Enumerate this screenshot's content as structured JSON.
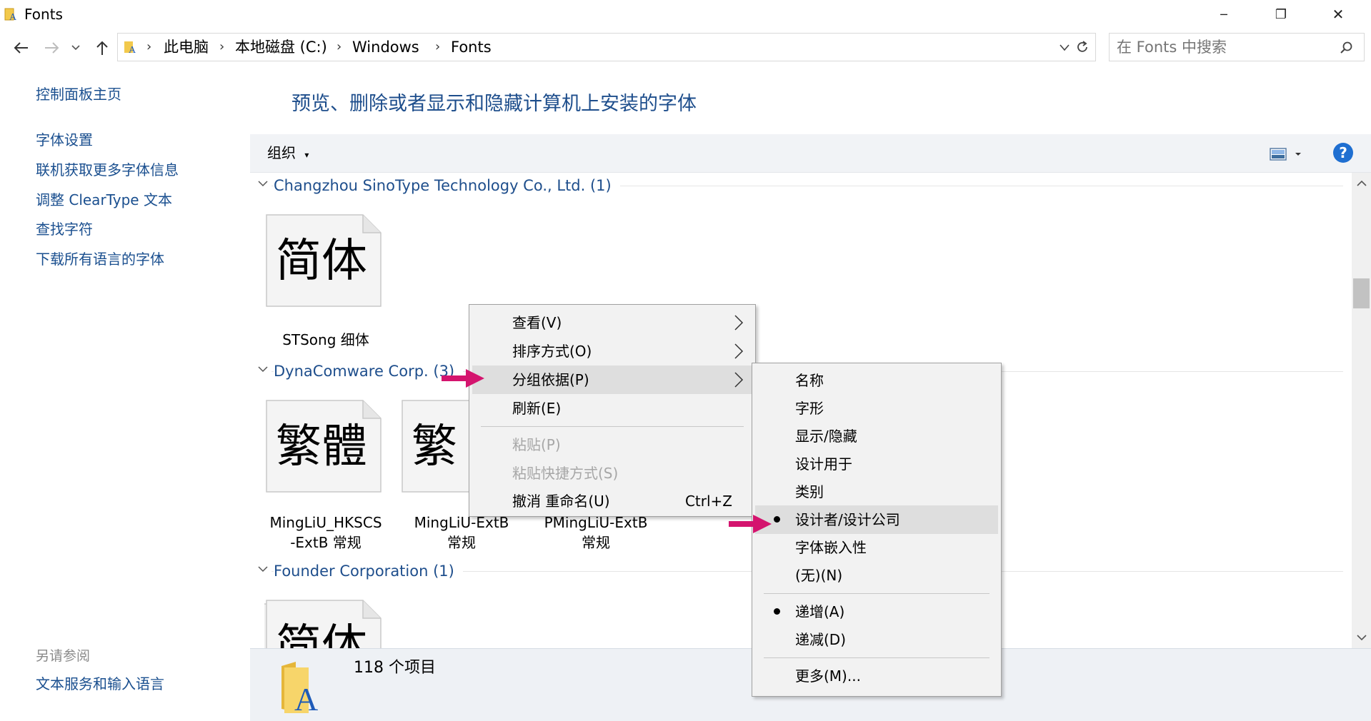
{
  "window": {
    "title": "Fonts",
    "controls": {
      "minimize": "─",
      "maximize": "❐",
      "close": "✕"
    }
  },
  "nav": {
    "breadcrumb": [
      "此电脑",
      "本地磁盘 (C:)",
      "Windows",
      "Fonts"
    ],
    "search_placeholder": "在 Fonts 中搜索"
  },
  "sidebar": {
    "links": [
      "控制面板主页",
      "字体设置",
      "联机获取更多字体信息",
      "调整 ClearType 文本",
      "查找字符",
      "下载所有语言的字体"
    ],
    "see_also_title": "另请参阅",
    "see_also_links": [
      "文本服务和输入语言"
    ]
  },
  "main": {
    "heading": "预览、删除或者显示和隐藏计算机上安装的字体",
    "toolbar": {
      "organize_label": "组织",
      "help_label": "?"
    },
    "groups": [
      {
        "title": "Changzhou SinoType Technology Co., Ltd. (1)",
        "items": [
          {
            "glyph": "简体",
            "name_line1": "STSong 细体",
            "name_line2": ""
          }
        ]
      },
      {
        "title": "DynaComware Corp. (3)",
        "items": [
          {
            "glyph": "繁體",
            "name_line1": "MingLiU_HKSCS",
            "name_line2": "-ExtB 常规"
          },
          {
            "glyph": "繁",
            "name_line1": "MingLiU-ExtB",
            "name_line2": "常规"
          },
          {
            "glyph": "",
            "name_line1": "PMingLiU-ExtB",
            "name_line2": "常规"
          }
        ]
      },
      {
        "title": "Founder Corporation (1)",
        "items": [
          {
            "glyph": "简体",
            "name_line1": "",
            "name_line2": ""
          }
        ]
      }
    ],
    "status": "118 个项目"
  },
  "context_menu": {
    "items": [
      {
        "label": "查看(V)",
        "submenu": true
      },
      {
        "label": "排序方式(O)",
        "submenu": true
      },
      {
        "label": "分组依据(P)",
        "submenu": true,
        "highlighted": true
      },
      {
        "label": "刷新(E)"
      },
      {
        "label": "粘贴(P)",
        "disabled": true
      },
      {
        "label": "粘贴快捷方式(S)",
        "disabled": true
      },
      {
        "label": "撤消 重命名(U)",
        "shortcut": "Ctrl+Z"
      }
    ]
  },
  "group_by_submenu": {
    "items": [
      {
        "label": "名称"
      },
      {
        "label": "字形"
      },
      {
        "label": "显示/隐藏"
      },
      {
        "label": "设计用于"
      },
      {
        "label": "类别"
      },
      {
        "label": "设计者/设计公司",
        "checked": true,
        "highlighted": true
      },
      {
        "label": "字体嵌入性"
      },
      {
        "label": "(无)(N)"
      },
      {
        "label": "递增(A)",
        "checked": true
      },
      {
        "label": "递减(D)"
      },
      {
        "label": "更多(M)..."
      }
    ]
  },
  "colors": {
    "link": "#1a4f8f",
    "heading": "#1e4e8c",
    "annotation_arrow": "#d4146e",
    "menu_bg": "#f2f2f2",
    "menu_highlight": "#dedede"
  }
}
